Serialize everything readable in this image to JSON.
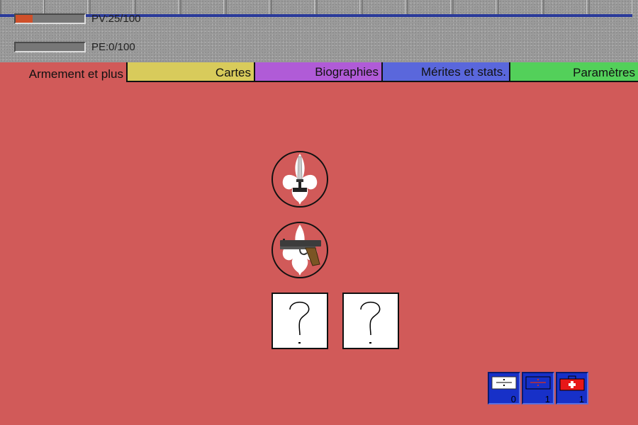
{
  "hud": {
    "pv": {
      "label": "PV:25/100",
      "fraction": 0.25,
      "color": "#d0502a"
    },
    "pe": {
      "label": "PE:0/100",
      "fraction": 0.0,
      "color": "#d0502a"
    }
  },
  "tabs": [
    {
      "label": "Armement et plus",
      "active": true
    },
    {
      "label": "Cartes"
    },
    {
      "label": "Biographies"
    },
    {
      "label": "Mérites et stats."
    },
    {
      "label": "Paramètres"
    }
  ],
  "equipment": {
    "melee": {
      "icon": "fleur-de-lis-dagger-icon"
    },
    "ranged": {
      "icon": "fleur-de-lis-pistol-icon"
    },
    "unknown_slots": [
      {
        "icon": "question-mark-icon"
      },
      {
        "icon": "question-mark-icon"
      }
    ]
  },
  "items": [
    {
      "icon": "medium-potion-icon",
      "count": "0"
    },
    {
      "icon": "large-potion-icon",
      "count": "1"
    },
    {
      "icon": "first-aid-kit-icon",
      "count": "1"
    }
  ],
  "colors": {
    "panel": "#d15a59",
    "tab_cartes": "#d8cb5b",
    "tab_biographies": "#b05bd7",
    "tab_merites": "#5a67dc",
    "tab_parametres": "#53d05a"
  }
}
